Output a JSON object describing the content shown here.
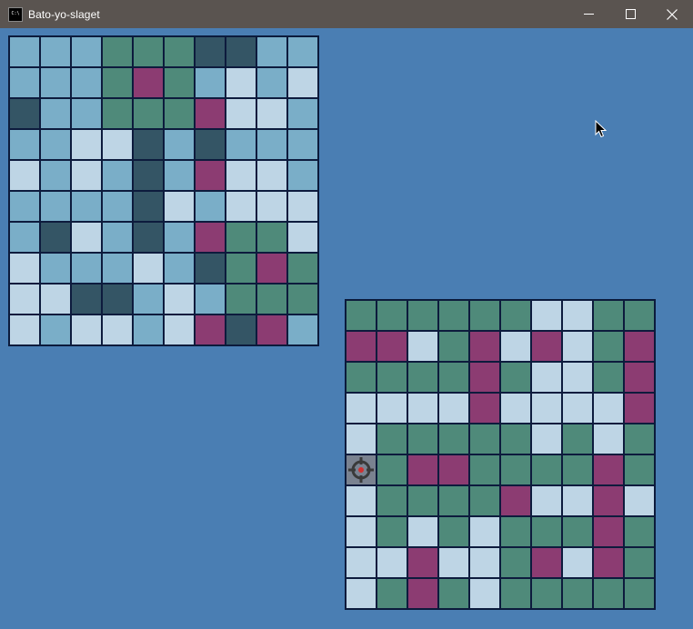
{
  "window": {
    "title": "Bato-yo-slaget",
    "icon_name": "console-app-icon",
    "icon_text": "C:\\",
    "controls": [
      "minimize",
      "maximize",
      "close"
    ]
  },
  "colors": {
    "background": "#4a7eb3",
    "m": "#7aaec8",
    "l": "#bed5e5",
    "g": "#4f8a7a",
    "d": "#345565",
    "p": "#8c3c72",
    "x": "#7a8290"
  },
  "own_board": {
    "rows": [
      [
        "m",
        "m",
        "m",
        "g",
        "g",
        "g",
        "d",
        "d",
        "m",
        "m"
      ],
      [
        "m",
        "m",
        "m",
        "g",
        "p",
        "g",
        "m",
        "l",
        "m",
        "l"
      ],
      [
        "d",
        "m",
        "m",
        "g",
        "g",
        "g",
        "p",
        "l",
        "l",
        "m"
      ],
      [
        "m",
        "m",
        "l",
        "l",
        "d",
        "m",
        "d",
        "m",
        "m",
        "m"
      ],
      [
        "l",
        "m",
        "l",
        "m",
        "d",
        "m",
        "p",
        "l",
        "l",
        "m"
      ],
      [
        "m",
        "m",
        "m",
        "m",
        "d",
        "l",
        "m",
        "l",
        "l",
        "l"
      ],
      [
        "m",
        "d",
        "l",
        "m",
        "d",
        "m",
        "p",
        "g",
        "g",
        "l"
      ],
      [
        "l",
        "m",
        "m",
        "m",
        "l",
        "m",
        "d",
        "g",
        "p",
        "g"
      ],
      [
        "l",
        "l",
        "d",
        "d",
        "m",
        "l",
        "m",
        "g",
        "g",
        "g"
      ],
      [
        "l",
        "m",
        "l",
        "l",
        "m",
        "l",
        "p",
        "d",
        "p",
        "m"
      ]
    ]
  },
  "enemy_board": {
    "rows": [
      [
        "g",
        "g",
        "g",
        "g",
        "g",
        "g",
        "l",
        "l",
        "g",
        "g"
      ],
      [
        "p",
        "p",
        "l",
        "g",
        "p",
        "l",
        "p",
        "l",
        "g",
        "p"
      ],
      [
        "g",
        "g",
        "g",
        "g",
        "p",
        "g",
        "l",
        "l",
        "g",
        "p"
      ],
      [
        "l",
        "l",
        "l",
        "l",
        "p",
        "l",
        "l",
        "l",
        "l",
        "p"
      ],
      [
        "l",
        "g",
        "g",
        "g",
        "g",
        "g",
        "l",
        "g",
        "l",
        "g"
      ],
      [
        "x",
        "g",
        "p",
        "p",
        "g",
        "g",
        "g",
        "g",
        "p",
        "g"
      ],
      [
        "l",
        "g",
        "g",
        "g",
        "g",
        "p",
        "l",
        "l",
        "p",
        "l"
      ],
      [
        "l",
        "g",
        "l",
        "g",
        "l",
        "g",
        "g",
        "g",
        "p",
        "g"
      ],
      [
        "l",
        "l",
        "p",
        "l",
        "l",
        "g",
        "p",
        "l",
        "p",
        "g"
      ],
      [
        "l",
        "g",
        "p",
        "g",
        "l",
        "g",
        "g",
        "g",
        "g",
        "g"
      ]
    ],
    "cursor_cell": {
      "row": 5,
      "col": 0
    }
  }
}
